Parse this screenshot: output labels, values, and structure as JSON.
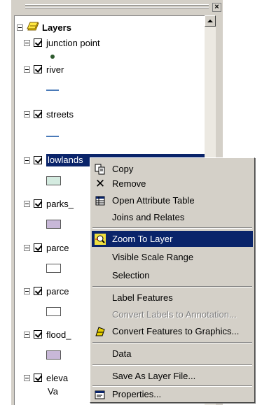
{
  "toc": {
    "root_label": "Layers",
    "layers": [
      {
        "label": "junction point",
        "checked": true
      },
      {
        "label": "river",
        "checked": true
      },
      {
        "label": "streets",
        "checked": true
      },
      {
        "label": "lowlands",
        "checked": true,
        "selected": true
      },
      {
        "label": "parks_",
        "checked": true
      },
      {
        "label": "parce",
        "checked": true
      },
      {
        "label": "parce",
        "checked": true
      },
      {
        "label": "flood_",
        "checked": true
      },
      {
        "label": "eleva",
        "checked": true
      }
    ],
    "legend_partial_label": "Va",
    "colors": {
      "point": "#2e5a2e",
      "line": "#4a7ab8",
      "lowlands_fill": "#d4ebe0",
      "parks_fill": "#c8b8d8",
      "parcels_fill": "#ffffff",
      "flood_fill": "#c8b8d8",
      "selection": "#0a246a"
    }
  },
  "context_menu": {
    "items": {
      "copy": "Copy",
      "remove": "Remove",
      "open_attribute_table": "Open Attribute Table",
      "joins_relates": "Joins and Relates",
      "zoom_to_layer": "Zoom To Layer",
      "visible_scale_range": "Visible Scale Range",
      "selection": "Selection",
      "label_features": "Label Features",
      "convert_labels": "Convert Labels to Annotation...",
      "convert_features": "Convert Features to Graphics...",
      "data": "Data",
      "save_as_layer": "Save As Layer File...",
      "properties": "Properties..."
    },
    "highlighted": "zoom_to_layer",
    "disabled": [
      "convert_labels"
    ]
  }
}
